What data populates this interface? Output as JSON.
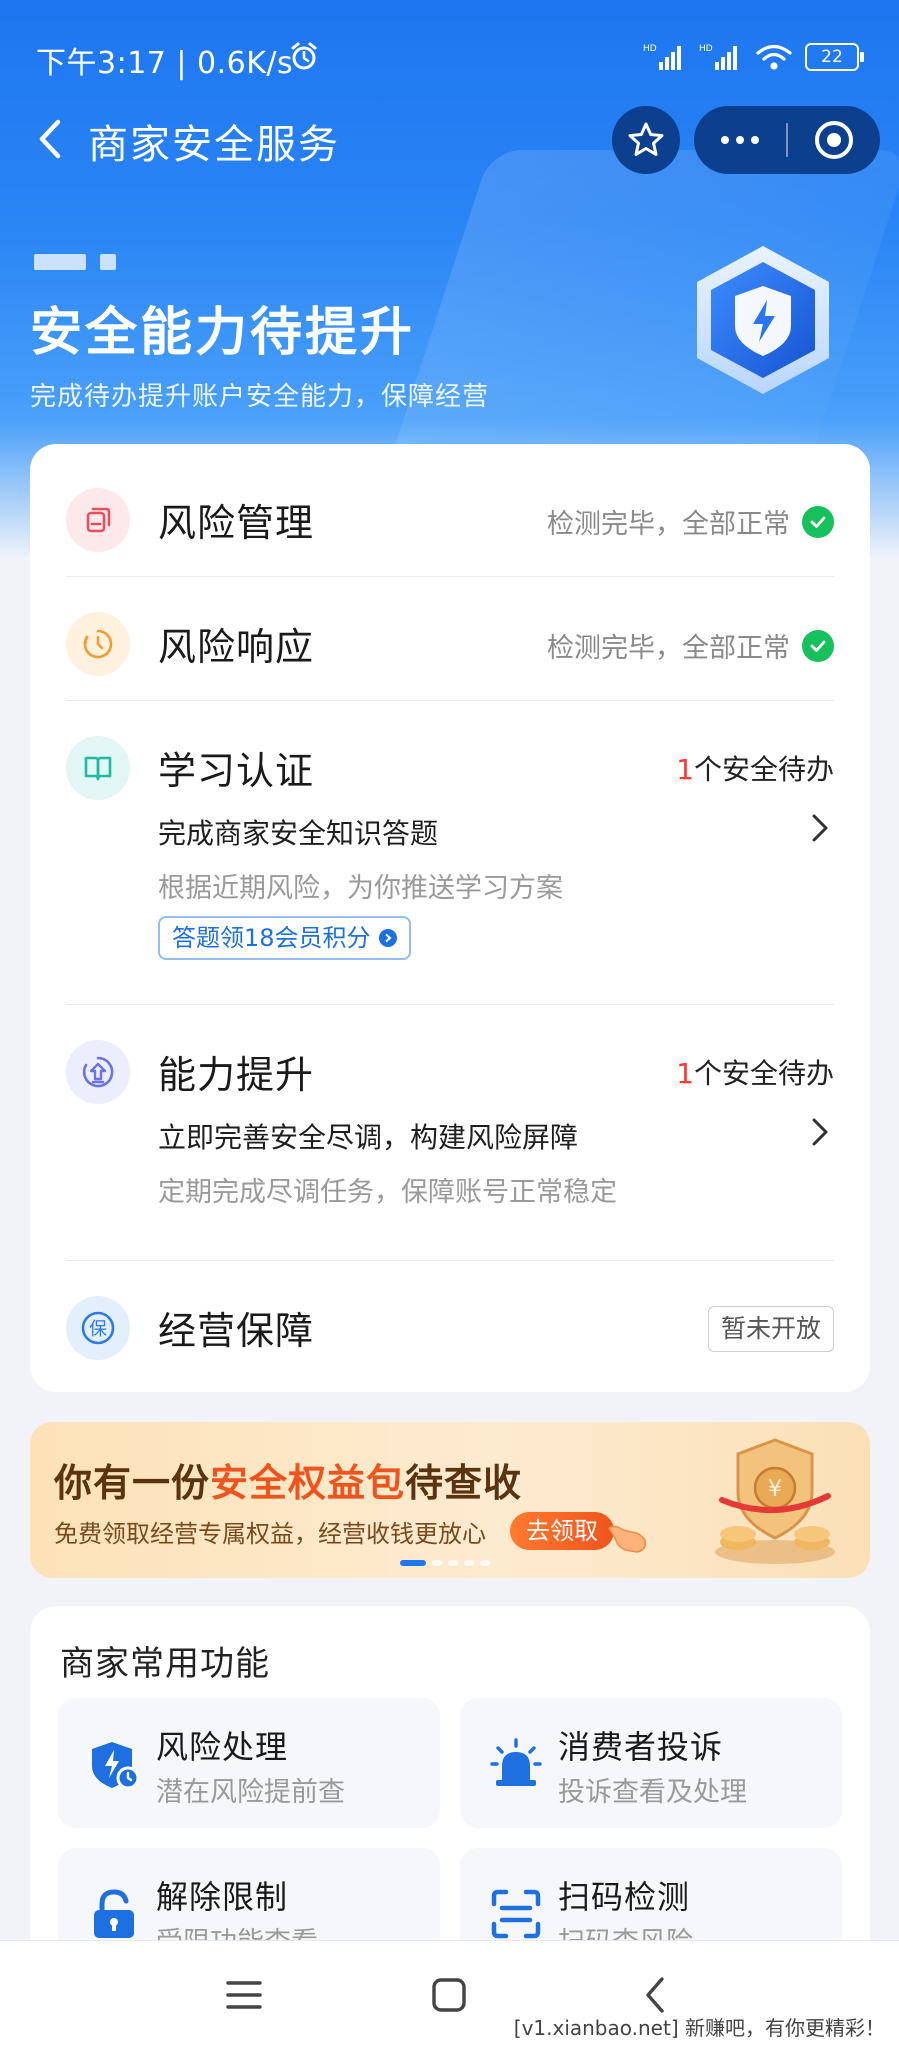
{
  "status_bar": {
    "time": "下午3:17 | 0.6K/s",
    "battery": "22",
    "network_labels": [
      "HD",
      "HD"
    ]
  },
  "nav": {
    "title": "商家安全服务"
  },
  "hero": {
    "title": "安全能力待提升",
    "subtitle": "完成待办提升账户安全能力，保障经营"
  },
  "items": [
    {
      "title": "风险管理",
      "status": "检测完毕，全部正常",
      "icon": "document-copy-icon",
      "icon_color": "#e8505b",
      "icon_bg": "#fde9ea"
    },
    {
      "title": "风险响应",
      "status": "检测完毕，全部正常",
      "icon": "clock-icon",
      "icon_color": "#f39b2e",
      "icon_bg": "#fef2df"
    },
    {
      "title": "学习认证",
      "todo_count": "1",
      "todo_label": "个安全待办",
      "task": "完成商家安全知识答题",
      "desc": "根据近期风险，为你推送学习方案",
      "tag": "答题领18会员积分",
      "icon": "book-icon",
      "icon_color": "#1fb9a6",
      "icon_bg": "#e2f6f3"
    },
    {
      "title": "能力提升",
      "todo_count": "1",
      "todo_label": "个安全待办",
      "task": "立即完善安全尽调，构建风险屏障",
      "desc": "定期完成尽调任务，保障账号正常稳定",
      "icon": "upgrade-icon",
      "icon_color": "#6a72e8",
      "icon_bg": "#eceefd"
    },
    {
      "title": "经营保障",
      "status_tag": "暂未开放",
      "icon": "insurance-icon",
      "icon_glyph": "保",
      "icon_color": "#2b7be8",
      "icon_bg": "#e4effd"
    }
  ],
  "banner": {
    "title_prefix": "你有一份",
    "title_highlight": "安全权益包",
    "title_suffix": "待查收",
    "subtitle": "免费领取经营专属权益，经营收钱更放心",
    "button": "去领取"
  },
  "functions": {
    "heading": "商家常用功能",
    "tiles": [
      {
        "title": "风险处理",
        "subtitle": "潜在风险提前查",
        "icon": "shield-clock-icon"
      },
      {
        "title": "消费者投诉",
        "subtitle": "投诉查看及处理",
        "icon": "alarm-light-icon"
      },
      {
        "title": "解除限制",
        "subtitle": "受限功能查看",
        "icon": "unlock-icon"
      },
      {
        "title": "扫码检测",
        "subtitle": "扫码查风险",
        "icon": "scan-icon"
      }
    ]
  },
  "watermark": "[v1.xianbao.net] 新赚吧，有你更精彩！",
  "colors": {
    "brand_blue": "#1e76f0",
    "success_green": "#16c05a",
    "todo_red": "#ff3b30",
    "banner_orange": "#f0541e"
  }
}
